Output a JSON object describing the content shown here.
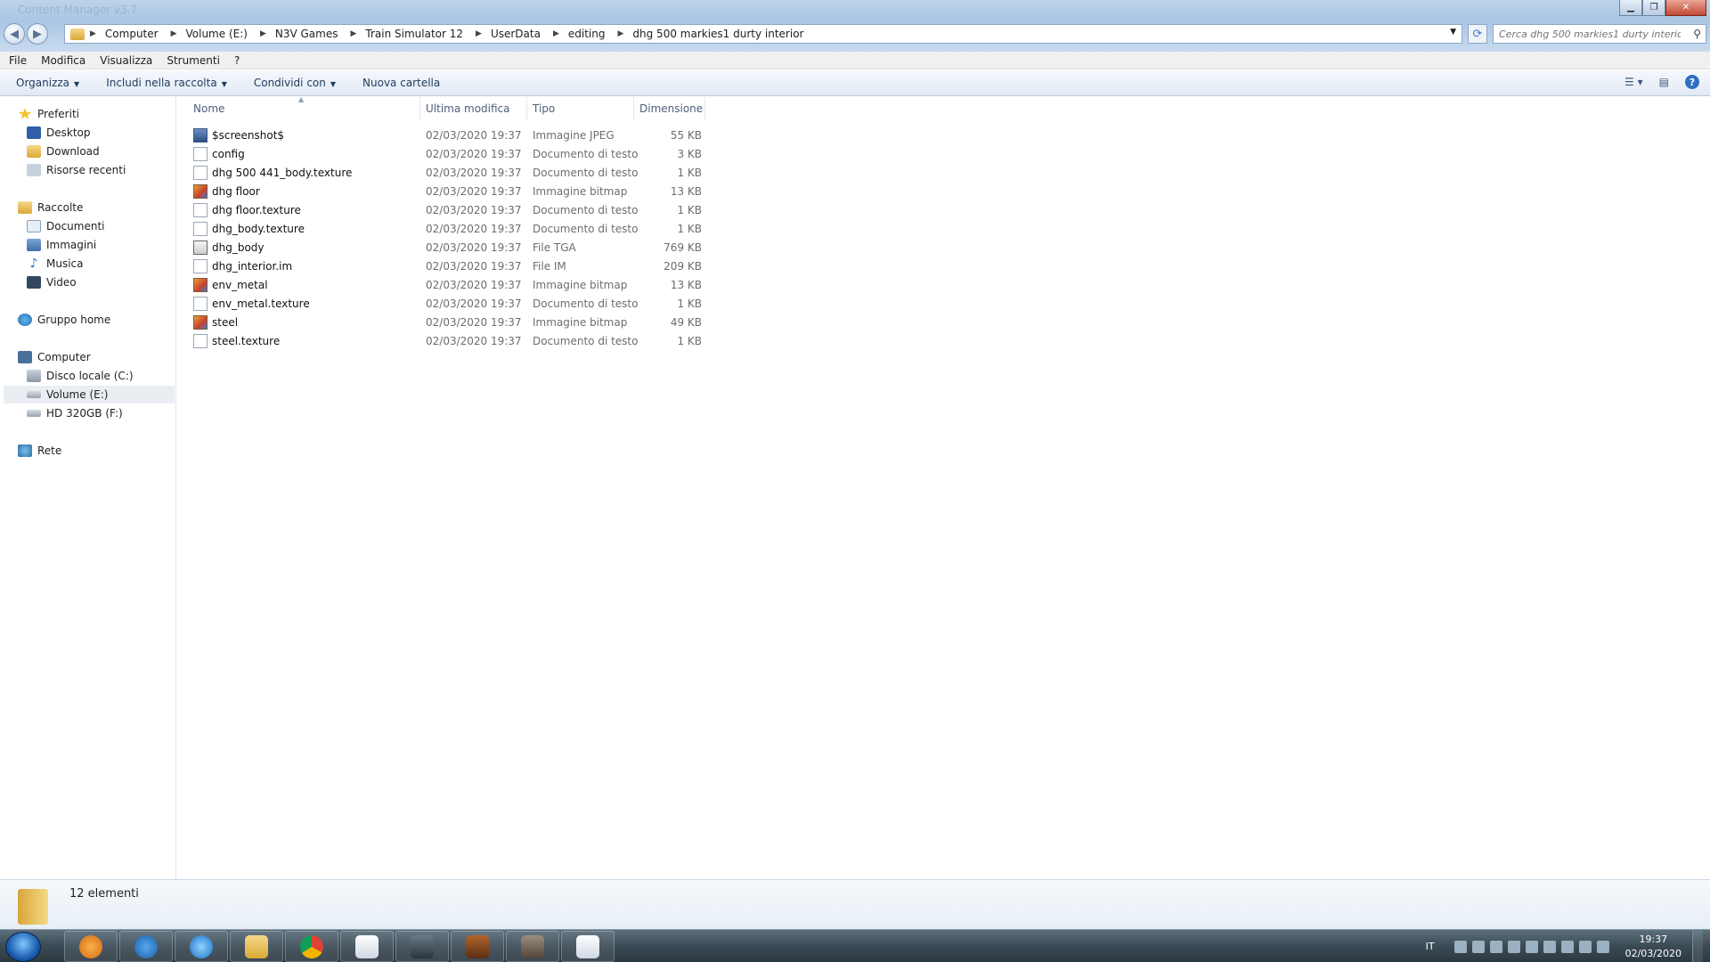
{
  "window": {
    "title": "Content Manager v3.7",
    "address": [
      "Computer",
      "Volume (E:)",
      "N3V Games",
      "Train Simulator 12",
      "UserData",
      "editing",
      "dhg 500 markies1 durty interior"
    ],
    "search_placeholder": "Cerca dhg 500 markies1 durty interior"
  },
  "menu": [
    "File",
    "Modifica",
    "Visualizza",
    "Strumenti",
    "?"
  ],
  "toolbar": {
    "organize": "Organizza",
    "include": "Includi nella raccolta",
    "share": "Condividi con",
    "new_folder": "Nuova cartella"
  },
  "nav": {
    "favorites": "Preferiti",
    "desktop": "Desktop",
    "download": "Download",
    "recent": "Risorse recenti",
    "libraries": "Raccolte",
    "documents": "Documenti",
    "pictures": "Immagini",
    "music": "Musica",
    "video": "Video",
    "homegroup": "Gruppo home",
    "computer": "Computer",
    "drive_c": "Disco locale (C:)",
    "drive_e": "Volume (E:)",
    "drive_f": "HD 320GB (F:)",
    "network": "Rete"
  },
  "columns": {
    "name": "Nome",
    "modified": "Ultima modifica",
    "type": "Tipo",
    "size": "Dimensione"
  },
  "files": [
    {
      "name": "$screenshot$",
      "date": "02/03/2020 19:37",
      "type": "Immagine JPEG",
      "size": "55 KB",
      "icon": "jpeg-icon"
    },
    {
      "name": "config",
      "date": "02/03/2020 19:37",
      "type": "Documento di testo",
      "size": "3 KB",
      "icon": "text-file-icon"
    },
    {
      "name": "dhg 500 441_body.texture",
      "date": "02/03/2020 19:37",
      "type": "Documento di testo",
      "size": "1 KB",
      "icon": "text-file-icon"
    },
    {
      "name": "dhg floor",
      "date": "02/03/2020 19:37",
      "type": "Immagine bitmap",
      "size": "13 KB",
      "icon": "bitmap-icon"
    },
    {
      "name": "dhg floor.texture",
      "date": "02/03/2020 19:37",
      "type": "Documento di testo",
      "size": "1 KB",
      "icon": "text-file-icon"
    },
    {
      "name": "dhg_body.texture",
      "date": "02/03/2020 19:37",
      "type": "Documento di testo",
      "size": "1 KB",
      "icon": "text-file-icon"
    },
    {
      "name": "dhg_body",
      "date": "02/03/2020 19:37",
      "type": "File TGA",
      "size": "769 KB",
      "icon": "tga-icon"
    },
    {
      "name": "dhg_interior.im",
      "date": "02/03/2020 19:37",
      "type": "File IM",
      "size": "209 KB",
      "icon": "generic-file-icon"
    },
    {
      "name": "env_metal",
      "date": "02/03/2020 19:37",
      "type": "Immagine bitmap",
      "size": "13 KB",
      "icon": "bitmap-icon"
    },
    {
      "name": "env_metal.texture",
      "date": "02/03/2020 19:37",
      "type": "Documento di testo",
      "size": "1 KB",
      "icon": "text-file-icon"
    },
    {
      "name": "steel",
      "date": "02/03/2020 19:37",
      "type": "Immagine bitmap",
      "size": "49 KB",
      "icon": "bitmap-icon"
    },
    {
      "name": "steel.texture",
      "date": "02/03/2020 19:37",
      "type": "Documento di testo",
      "size": "1 KB",
      "icon": "text-file-icon"
    }
  ],
  "status": {
    "count": "12 elementi"
  },
  "taskbar": {
    "lang": "IT",
    "time": "19:37",
    "date": "02/03/2020"
  },
  "colors": {
    "accent": "#2f6fc2",
    "selection": "#eaeef3"
  }
}
